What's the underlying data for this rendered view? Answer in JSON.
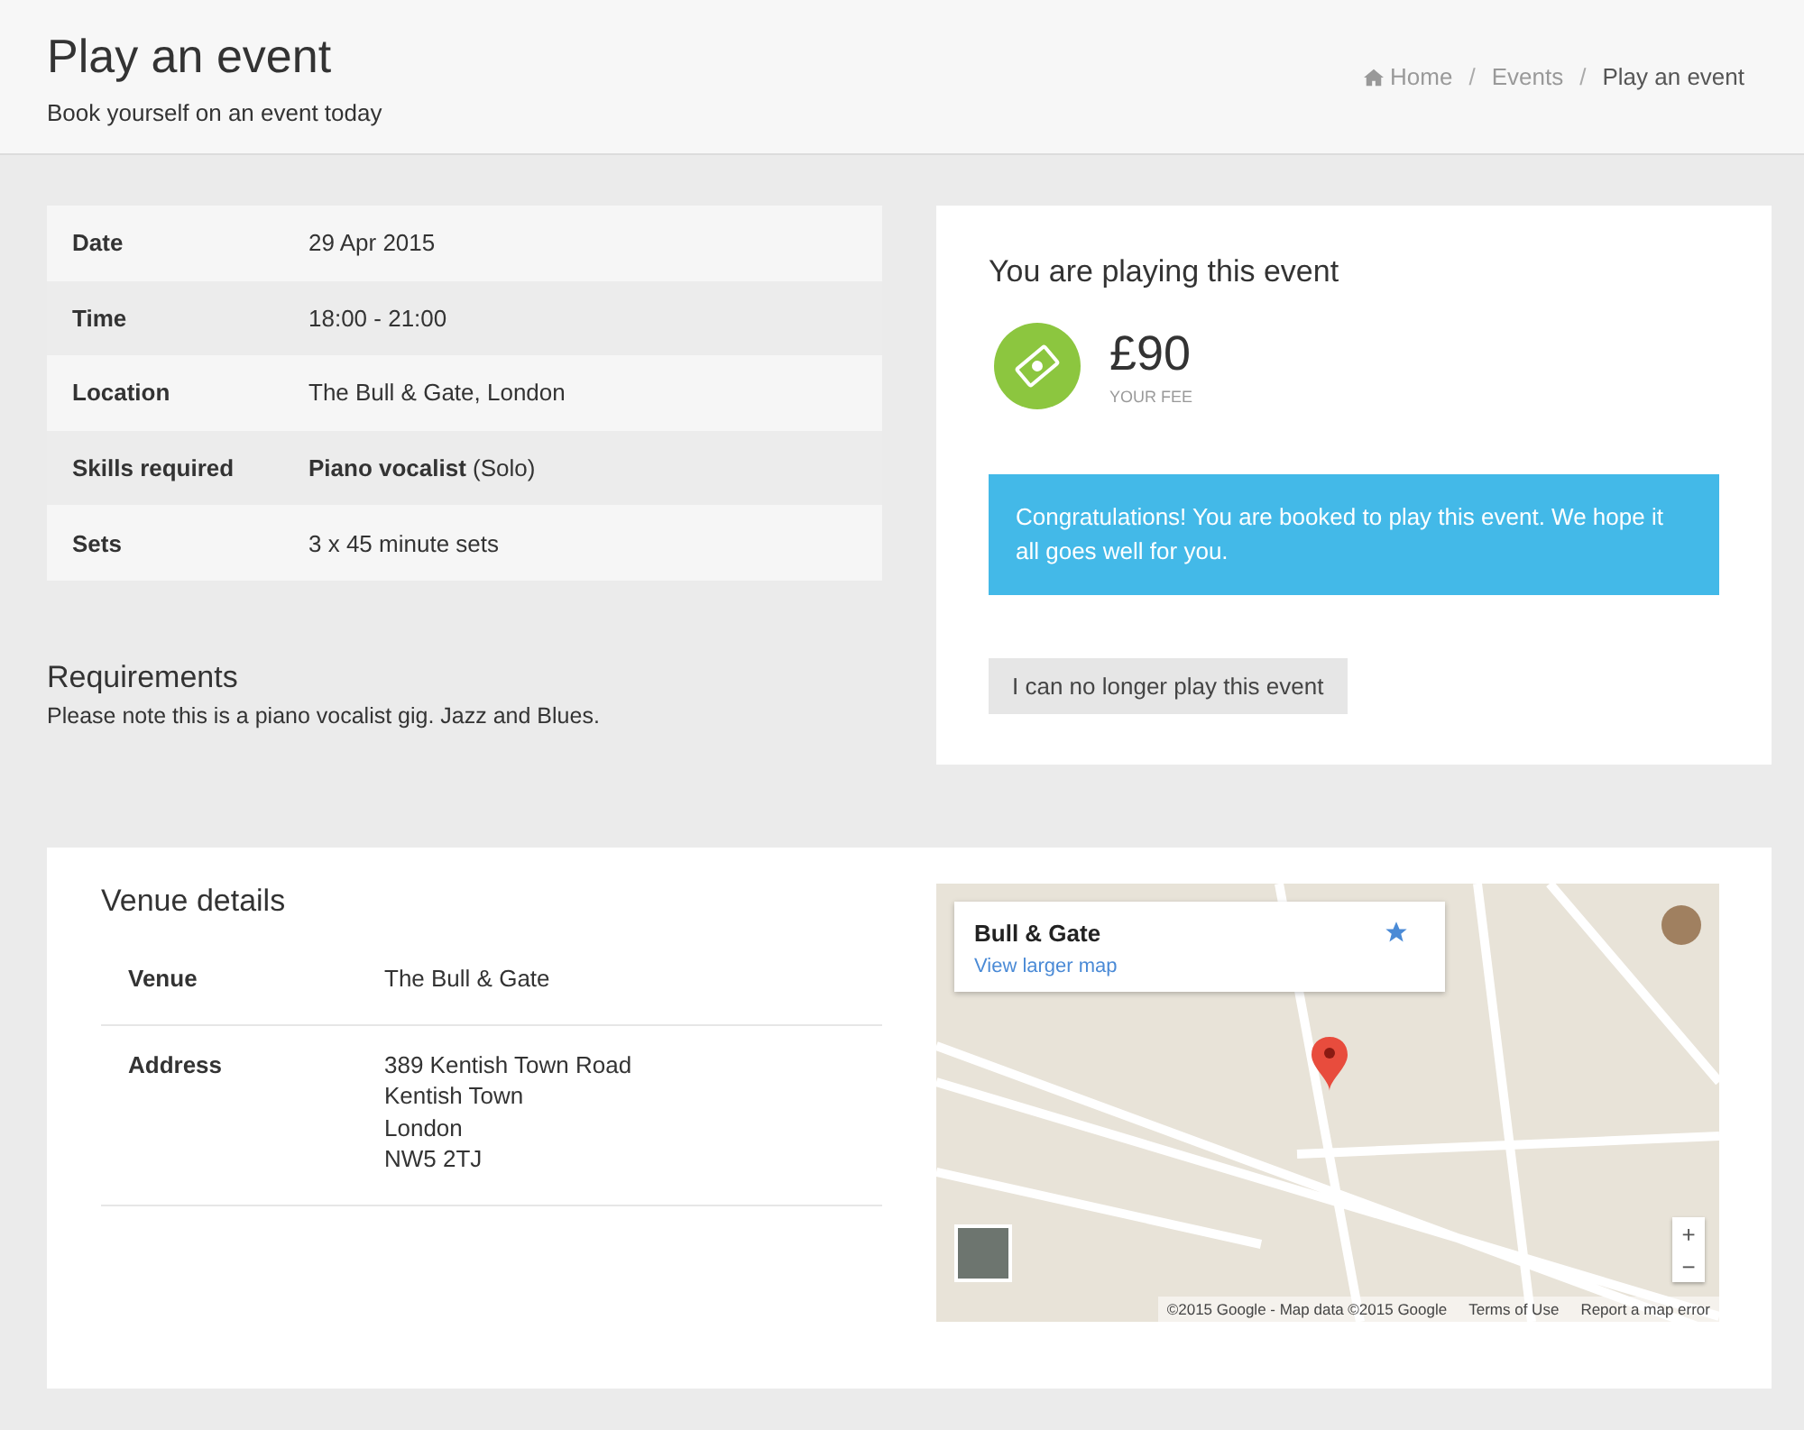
{
  "header": {
    "title": "Play an event",
    "subtitle": "Book yourself on an event today",
    "breadcrumb_separator": "/",
    "breadcrumb": [
      {
        "label": "Home",
        "kind": "home"
      },
      {
        "label": "Events",
        "kind": "link"
      },
      {
        "label": "Play an event",
        "kind": "current"
      }
    ]
  },
  "details": [
    {
      "label": "Date",
      "value": "29 Apr 2015"
    },
    {
      "label": "Time",
      "value": "18:00 - 21:00"
    },
    {
      "label": "Location",
      "value": "The Bull & Gate, London"
    },
    {
      "label": "Skills required",
      "value": "**Piano vocalist** (Solo)"
    },
    {
      "label": "Sets",
      "value": "3 x 45 minute sets"
    }
  ],
  "requirements": {
    "title": "Requirements",
    "text": "Please note this is a piano vocalist gig. Jazz and Blues."
  },
  "booking": {
    "title": "You are playing this event",
    "fee": "£90",
    "fee_label": "YOUR FEE",
    "alert": "Congratulations! You are booked to play this event. We hope it all goes well for you.",
    "cancel_button": "I can no longer play this event"
  },
  "venue": {
    "title": "Venue details",
    "rows": [
      {
        "label": "Venue",
        "lines": [
          "The Bull & Gate"
        ]
      },
      {
        "label": "Address",
        "lines": [
          "389 Kentish Town Road",
          "Kentish Town",
          "London",
          "NW5 2TJ"
        ]
      }
    ]
  },
  "map": {
    "place": "Bull & Gate",
    "link": "View larger map",
    "footer": [
      "©2015 Google - Map data ©2015 Google",
      "Terms of Use",
      "Report a map error"
    ],
    "zoom": [
      "+",
      "−"
    ]
  }
}
